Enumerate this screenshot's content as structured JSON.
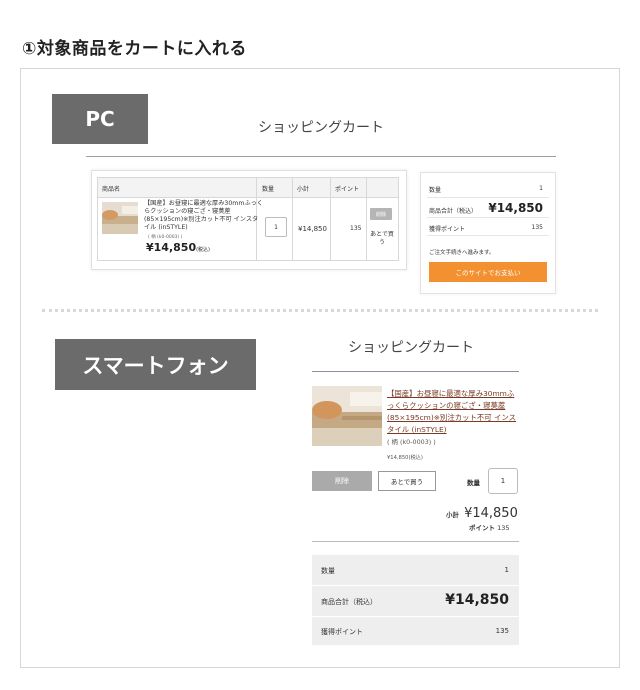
{
  "step_title": "①対象商品をカートに入れる",
  "pc": {
    "label": "PC",
    "cart_title": "ショッピングカート",
    "table": {
      "headers": [
        "商品名",
        "数量",
        "小計",
        "ポイント"
      ],
      "product_name": "【国産】お昼寝に最適な厚み30mmふっくらクッションの寝ござ・寝茣蓙(85×195cm)※別注カット不可 インスタイル (inSTYLE)",
      "variant": "( 柄 (k0-0003) )",
      "price": "¥14,850",
      "price_tax": "(税込)",
      "quantity": "1",
      "subtotal": "¥14,850",
      "points": "135",
      "delete_label": "削除",
      "later_label": "あとで買う"
    },
    "summary": {
      "qty_label": "数量",
      "qty_value": "1",
      "total_label": "商品合計（税込）",
      "total_value": "¥14,850",
      "points_label": "獲得ポイント",
      "points_value": "135",
      "note": "ご注文手続きへ進みます。",
      "checkout_label": "このサイトでお支払い",
      "checkout_color": "#f39130"
    }
  },
  "sp": {
    "label": "スマートフォン",
    "cart_title": "ショッピングカート",
    "product_name": "【国産】お昼寝に最適な厚み30mmふっくらクッションの寝ござ・寝茣蓙(85×195cm)※別注カット不可 インスタイル (inSTYLE)",
    "variant": "( 柄 (k0-0003) )",
    "unit_price": "¥14,850(税込)",
    "delete_label": "削除",
    "later_label": "あとで買う",
    "qty_label": "数量",
    "qty_value": "1",
    "subtotal_label": "小計",
    "subtotal_value": "¥14,850",
    "points_label": "ポイント",
    "points_value": "135",
    "summary": {
      "qty_label": "数量",
      "qty_value": "1",
      "total_label": "商品合計（税込）",
      "total_value": "¥14,850",
      "points_label": "獲得ポイント",
      "points_value": "135"
    }
  }
}
